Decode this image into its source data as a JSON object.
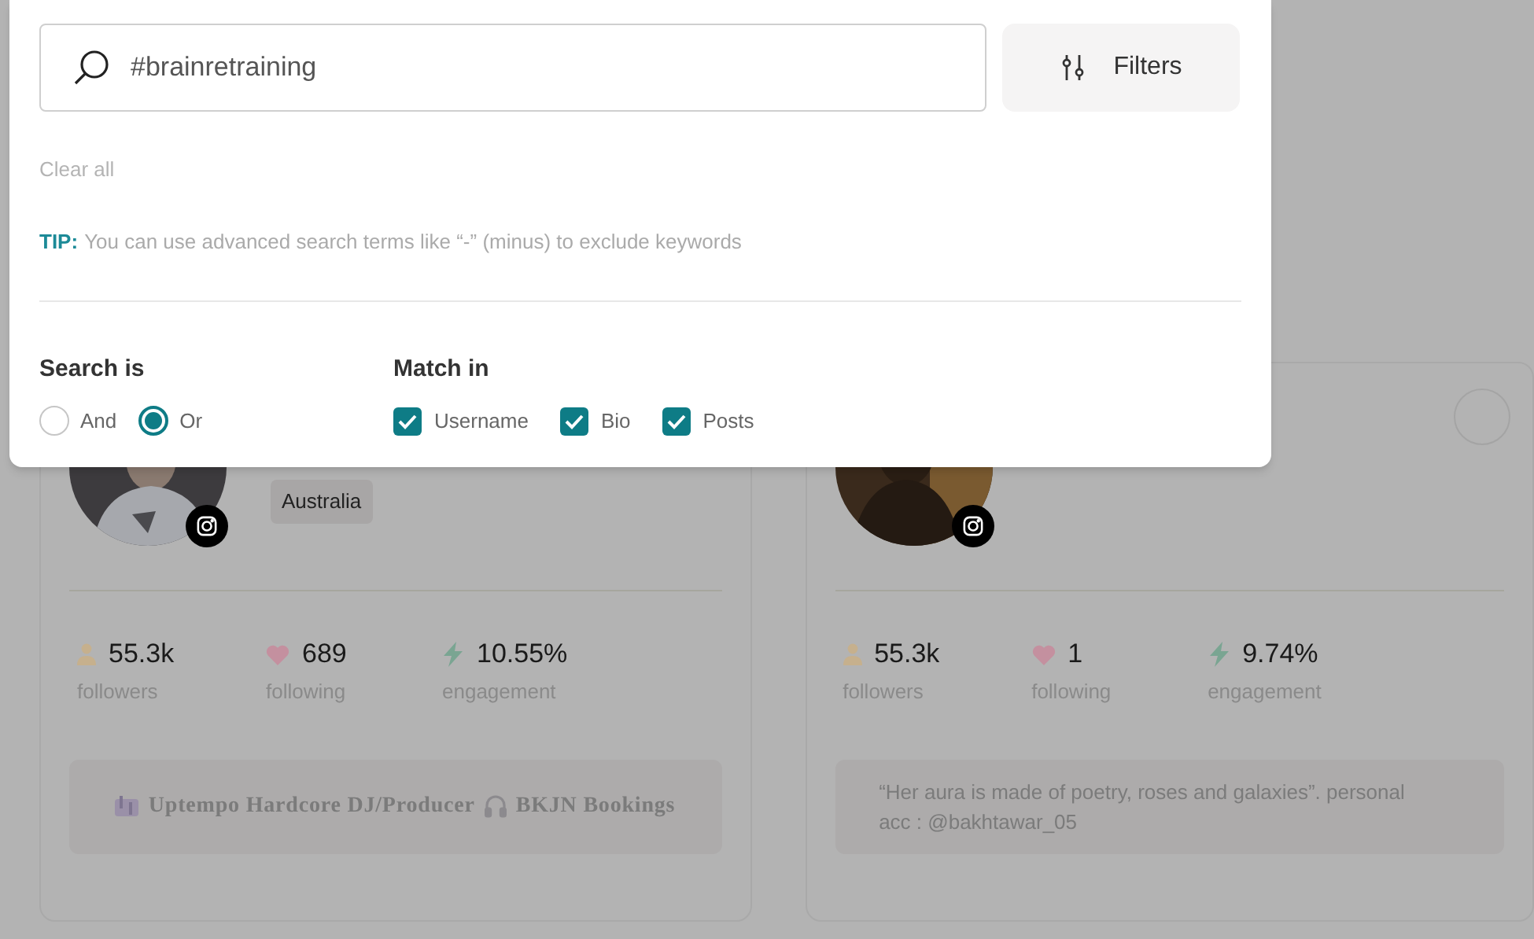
{
  "search_panel": {
    "search": {
      "value": "#brainretraining"
    },
    "filters_button": "Filters",
    "clear_all": "Clear all",
    "tip": {
      "label": "TIP:",
      "text": "You can use advanced search terms like “-” (minus) to exclude keywords"
    },
    "search_is": {
      "title": "Search is",
      "options": [
        {
          "label": "And",
          "selected": false
        },
        {
          "label": "Or",
          "selected": true
        }
      ]
    },
    "match_in": {
      "title": "Match in",
      "options": [
        {
          "label": "Username",
          "checked": true
        },
        {
          "label": "Bio",
          "checked": true
        },
        {
          "label": "Posts",
          "checked": true
        }
      ]
    }
  },
  "cards": [
    {
      "tag": "Australia",
      "stats": [
        {
          "kind": "followers",
          "value": "55.3k",
          "label": "followers"
        },
        {
          "kind": "following",
          "value": "689",
          "label": "following"
        },
        {
          "kind": "engagement",
          "value": "10.55%",
          "label": "engagement"
        }
      ],
      "bio_serif": true,
      "bio": [
        {
          "kind": "mixer"
        },
        {
          "kind": "text",
          "text": "Uptempo Hardcore DJ/Producer"
        },
        {
          "kind": "headphones"
        },
        {
          "kind": "text",
          "text": "BKJN Bookings"
        }
      ]
    },
    {
      "selected": false,
      "stats": [
        {
          "kind": "followers",
          "value": "55.3k",
          "label": "followers"
        },
        {
          "kind": "following",
          "value": "1",
          "label": "following"
        },
        {
          "kind": "engagement",
          "value": "9.74%",
          "label": "engagement"
        }
      ],
      "bio_serif": false,
      "bio": [
        {
          "kind": "text",
          "text": "“Her aura is made of poetry, roses and galaxies”. personal acc : @bakhtawar_05"
        }
      ]
    }
  ]
}
